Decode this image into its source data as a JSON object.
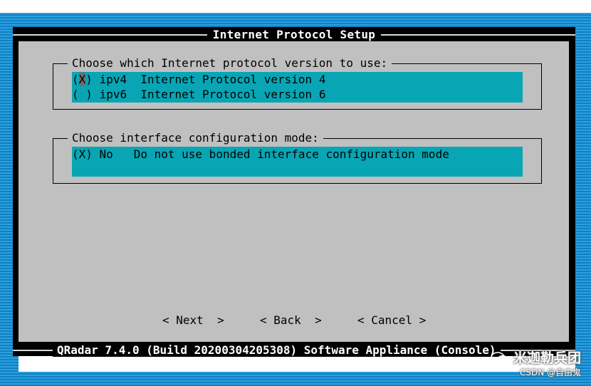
{
  "dialog": {
    "title": "Internet Protocol Setup"
  },
  "protocol_group": {
    "label": "Choose which Internet protocol version to use:",
    "options": [
      {
        "mark_open": "(",
        "mark_char": "X",
        "mark_close": ")",
        "key": "ipv4",
        "description": "Internet Protocol version 4",
        "selected": true
      },
      {
        "mark_open": "(",
        "mark_char": " ",
        "mark_close": ")",
        "key": "ipv6",
        "description": "Internet Protocol version 6",
        "selected": false
      }
    ]
  },
  "interface_group": {
    "label": "Choose interface configuration mode:",
    "options": [
      {
        "mark": "(X)",
        "key": "No",
        "description": "Do not use bonded interface configuration mode",
        "selected": true
      }
    ]
  },
  "buttons": {
    "next": "< Next  >",
    "back": "< Back  >",
    "cancel": "< Cancel >"
  },
  "footer": {
    "text": "QRadar 7.4.0 (Build 20200304205308) Software Appliance (Console)"
  },
  "watermark": {
    "main": "米迦勒兵团",
    "sub": "CSDN @自由鬼"
  },
  "colors": {
    "dialog_bg": "#c0c0c0",
    "selection_bg": "#08a6b5",
    "screen_bg": "#1a8fd0",
    "border": "#000000"
  }
}
